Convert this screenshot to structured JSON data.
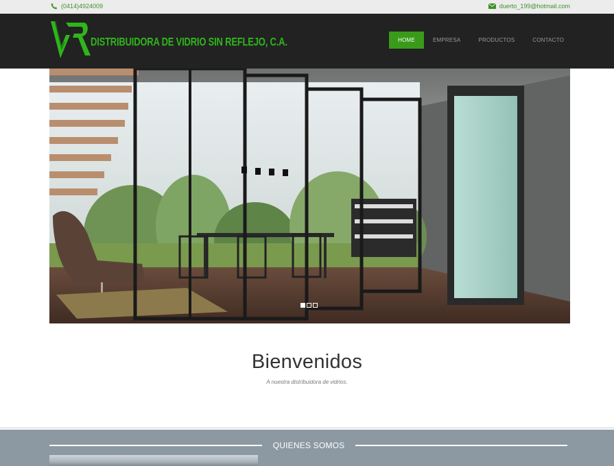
{
  "topbar": {
    "phone": "(0414)4924009",
    "phone_icon": "phone-icon",
    "email": "duerto_199@hotmail.com",
    "email_icon": "envelope-icon"
  },
  "header": {
    "logo_text": "DISTRIBUIDORA DE VIDRIO SIN REFLEJO, C.A.",
    "logo_icon": "vr-logo-icon"
  },
  "nav": {
    "items": [
      {
        "label": "HOME",
        "active": true
      },
      {
        "label": "EMPRESA",
        "active": false
      },
      {
        "label": "PRODUCTOS",
        "active": false
      },
      {
        "label": "CONTACTO",
        "active": false
      }
    ]
  },
  "slider": {
    "slide_count": 3,
    "active_slide": 1
  },
  "welcome": {
    "title": "Bienvenidos",
    "subtitle": "A nuestra distribuidora de vidrios."
  },
  "about": {
    "title": "QUIENES SOMOS"
  },
  "colors": {
    "brand_green": "#3a9a1a",
    "logo_green": "#2fb51c",
    "header_bg": "#222222",
    "section_bg": "#8c98a2"
  }
}
